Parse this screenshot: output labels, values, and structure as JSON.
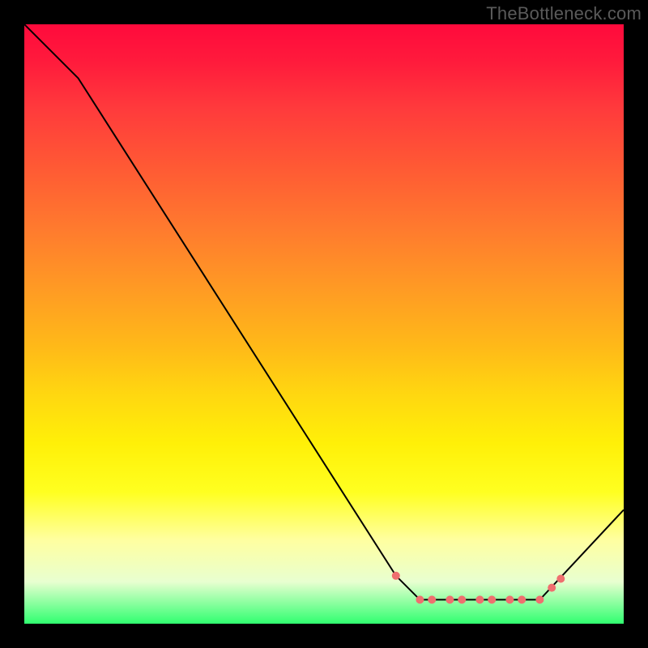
{
  "watermark": "TheBottleneck.com",
  "chart_data": {
    "type": "line",
    "title": "",
    "xlabel": "",
    "ylabel": "",
    "xlim": [
      0,
      100
    ],
    "ylim": [
      0,
      100
    ],
    "grid": false,
    "legend": false,
    "series": [
      {
        "name": "curve",
        "x": [
          0,
          9,
          62,
          66,
          86,
          100
        ],
        "y": [
          100,
          91,
          8,
          4,
          4,
          19
        ],
        "stroke": "#000000",
        "width": 2
      }
    ],
    "markers": {
      "name": "highlight-points",
      "color": "#ef6f6f",
      "radius": 5,
      "points": [
        {
          "x": 62,
          "y": 8
        },
        {
          "x": 66,
          "y": 4
        },
        {
          "x": 68,
          "y": 4
        },
        {
          "x": 71,
          "y": 4
        },
        {
          "x": 73,
          "y": 4
        },
        {
          "x": 76,
          "y": 4
        },
        {
          "x": 78,
          "y": 4
        },
        {
          "x": 81,
          "y": 4
        },
        {
          "x": 83,
          "y": 4
        },
        {
          "x": 86,
          "y": 4
        },
        {
          "x": 88,
          "y": 6
        },
        {
          "x": 89.5,
          "y": 7.5
        }
      ]
    },
    "background_gradient": {
      "top": "#ff0a3c",
      "mid": "#ffff20",
      "bottom": "#30ff70"
    }
  }
}
